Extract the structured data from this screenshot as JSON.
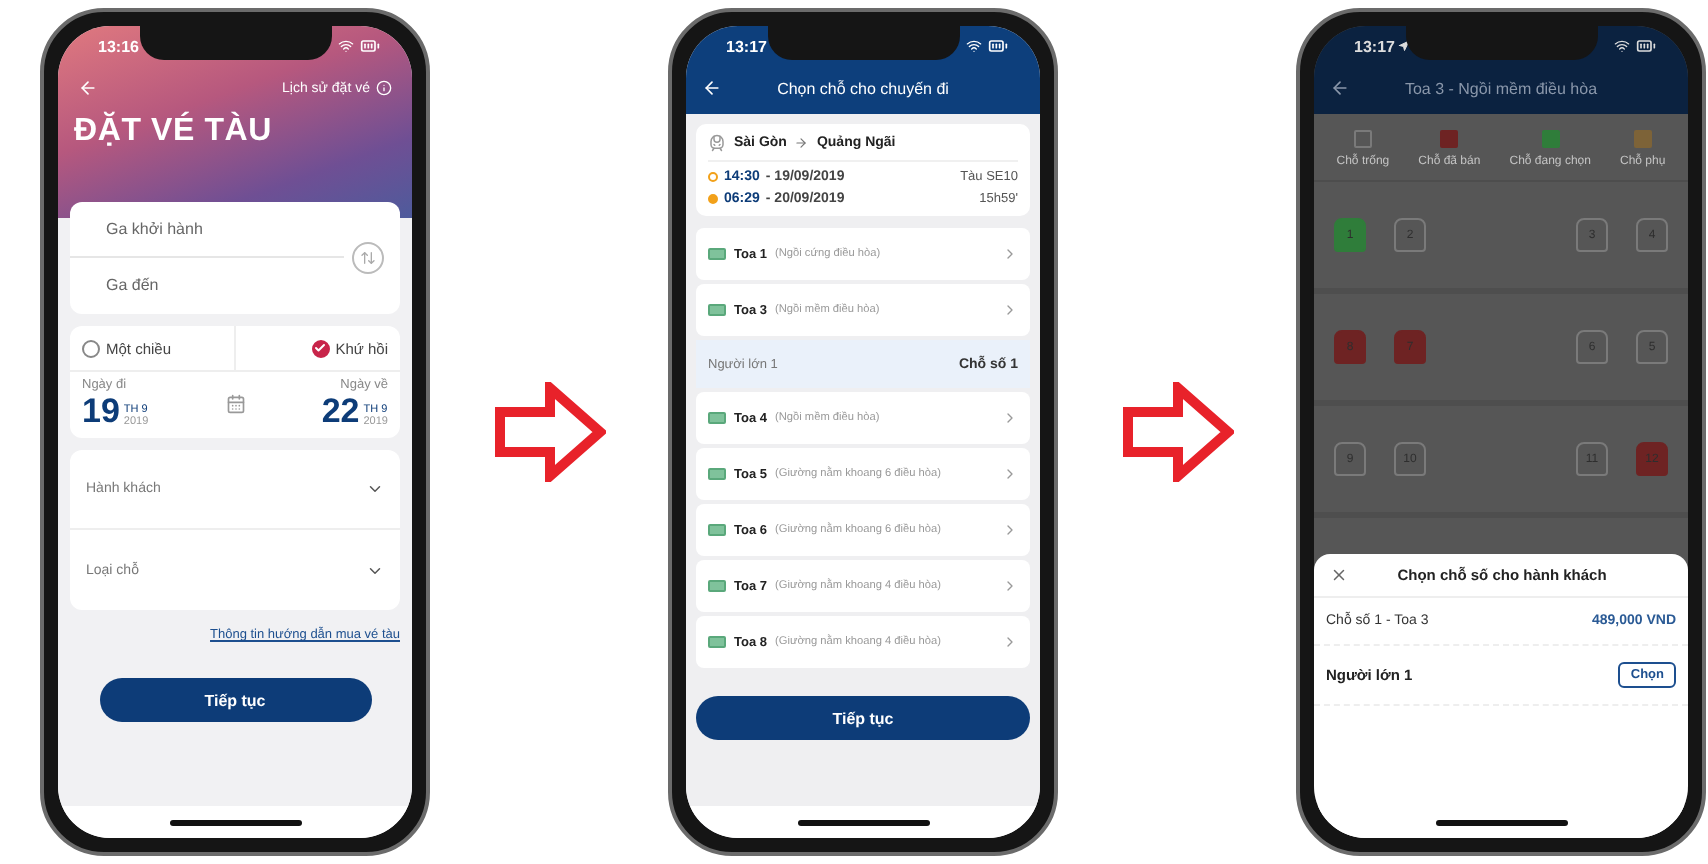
{
  "booking_screen": {
    "status_time": "13:16",
    "history_link": "Lịch sử đặt vé",
    "title": "ĐẶT VÉ TÀU",
    "departure_placeholder": "Ga khởi hành",
    "arrival_placeholder": "Ga đến",
    "trip_types": [
      {
        "label": "Một chiều",
        "selected": false
      },
      {
        "label": "Khứ hồi",
        "selected": true
      }
    ],
    "dates": [
      {
        "label": "Ngày đi",
        "day": "19",
        "month": "TH 9",
        "year": "2019"
      },
      {
        "label": "Ngày về",
        "day": "22",
        "month": "TH 9",
        "year": "2019"
      }
    ],
    "selects": [
      {
        "label": "Hành khách"
      },
      {
        "label": "Loại chỗ"
      }
    ],
    "guide_link": "Thông tin hướng dẫn mua vé tàu",
    "button": "Tiếp tục"
  },
  "coach_screen": {
    "status_time": "13:17",
    "title": "Chọn chỗ cho chuyến đi",
    "route": {
      "from": "Sài Gòn",
      "to": "Quảng Ngãi"
    },
    "legs": [
      {
        "time": "14:30",
        "date": "- 19/09/2019",
        "info": "Tàu SE10"
      },
      {
        "time": "06:29",
        "date": "- 20/09/2019",
        "info": "15h59'"
      }
    ],
    "rows": [
      {
        "kind": "coach",
        "name": "Toa 1",
        "type": "(Ngồi cứng điều hòa)"
      },
      {
        "kind": "coach",
        "name": "Toa 3",
        "type": "(Ngồi mềm điều hòa)"
      },
      {
        "kind": "assignment",
        "passenger": "Người lớn 1",
        "seat": "Chỗ số 1"
      },
      {
        "kind": "coach",
        "name": "Toa 4",
        "type": "(Ngồi mềm điều hòa)"
      },
      {
        "kind": "coach",
        "name": "Toa 5",
        "type": "(Giường nằm khoang 6 điều hòa)"
      },
      {
        "kind": "coach",
        "name": "Toa 6",
        "type": "(Giường nằm khoang 6 điều hòa)"
      },
      {
        "kind": "coach",
        "name": "Toa 7",
        "type": "(Giường nằm khoang 4 điều hòa)"
      },
      {
        "kind": "coach",
        "name": "Toa 8",
        "type": "(Giường nằm khoang 4 điều hòa)"
      }
    ],
    "button": "Tiếp tục"
  },
  "seat_screen": {
    "status_time": "13:17",
    "title": "Toa 3 - Ngồi mềm điều hòa",
    "legend": [
      {
        "label": "Chỗ trống",
        "kind": "outline",
        "color": "#7a7a7a"
      },
      {
        "label": "Chỗ đã bán",
        "kind": "fill",
        "color": "#6e2323"
      },
      {
        "label": "Chỗ đang chọn",
        "kind": "fill",
        "color": "#2f7d3a"
      },
      {
        "label": "Chỗ phụ",
        "kind": "fill",
        "color": "#7d6338"
      }
    ],
    "seat_rows": [
      [
        {
          "number": "1",
          "kind": "selected"
        },
        {
          "number": "2",
          "kind": "empty"
        },
        {
          "number": "3",
          "kind": "empty"
        },
        {
          "number": "4",
          "kind": "empty"
        }
      ],
      [
        {
          "number": "8",
          "kind": "sold"
        },
        {
          "number": "7",
          "kind": "sold"
        },
        {
          "number": "6",
          "kind": "empty"
        },
        {
          "number": "5",
          "kind": "empty"
        }
      ],
      [
        {
          "number": "9",
          "kind": "empty"
        },
        {
          "number": "10",
          "kind": "empty"
        },
        {
          "number": "11",
          "kind": "empty"
        },
        {
          "number": "12",
          "kind": "sold"
        }
      ]
    ],
    "sheet": {
      "title": "Chọn chỗ số cho hành khách",
      "seat": "Chỗ số 1 - Toa 3",
      "price": "489,000 VND",
      "passenger": "Người lớn 1",
      "button": "Chọn"
    }
  }
}
